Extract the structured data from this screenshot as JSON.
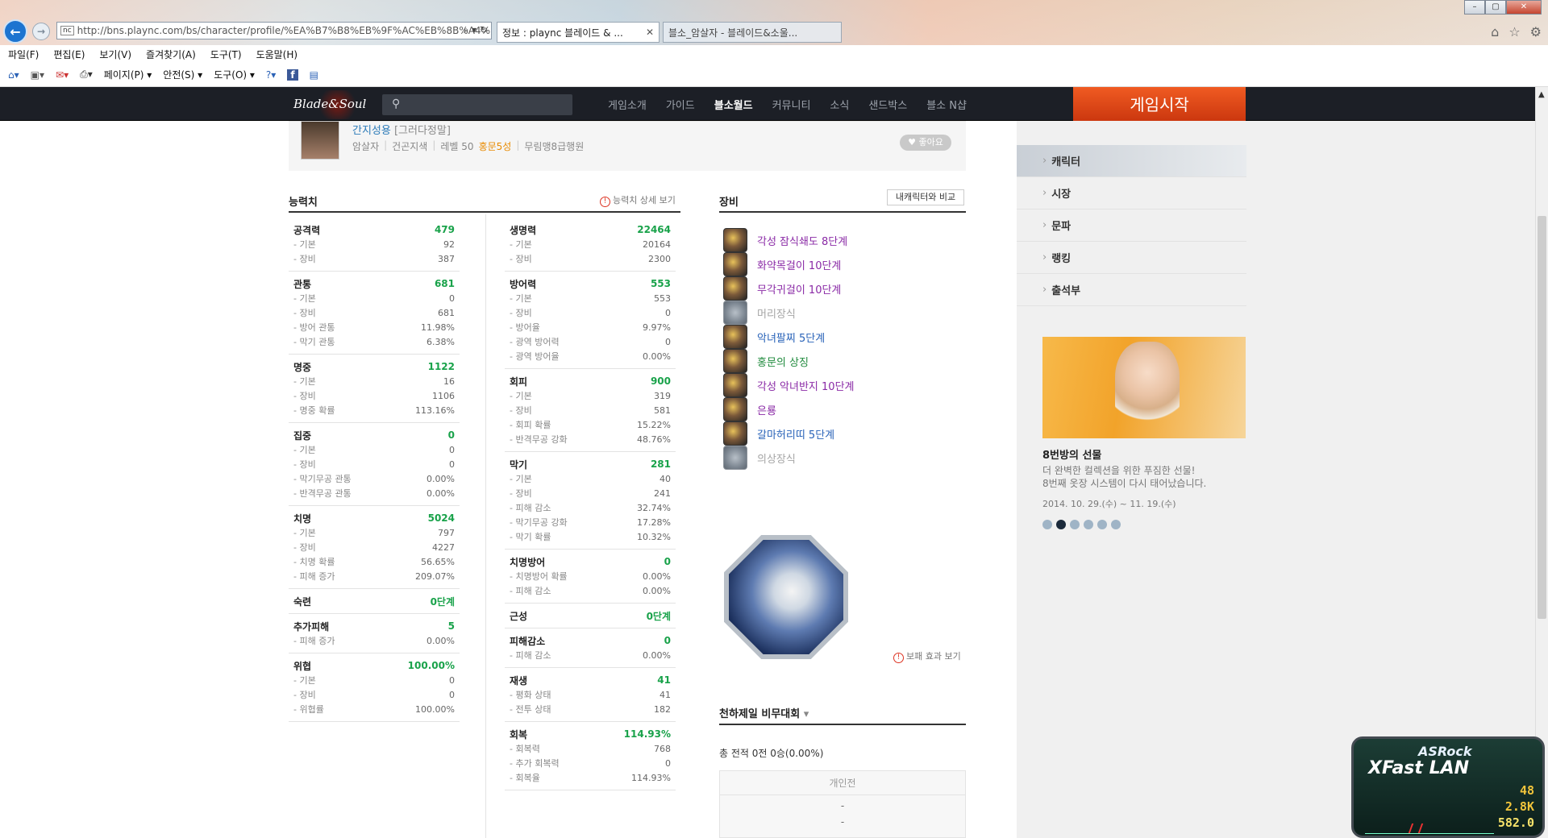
{
  "browser": {
    "url": "http://bns.plaync.com/bs/character/profile/%EA%B7%B8%EB%9F%AC%EB%8B%A4%",
    "tabs": [
      {
        "label": "정보 : plaync 블레이드 & ..."
      },
      {
        "label": "블소_암살자 - 블레이드&소울..."
      }
    ],
    "menu": [
      "파일(F)",
      "편집(E)",
      "보기(V)",
      "즐겨찾기(A)",
      "도구(T)",
      "도움말(H)"
    ],
    "cmd": [
      "페이지(P) ▾",
      "안전(S) ▾",
      "도구(O) ▾"
    ]
  },
  "site": {
    "logo": "Blade&Soul",
    "nav": [
      "게임소개",
      "가이드",
      "블소월드",
      "커뮤니티",
      "소식",
      "샌드박스",
      "블소 N샵"
    ],
    "active_nav": "블소월드",
    "start_button": "게임시작"
  },
  "profile": {
    "name": "간지성용",
    "server": "[그러다정말]",
    "class": "암살자",
    "race": "건곤지색",
    "level": "레벨 50",
    "mastery": "홍문5성",
    "faction": "무림맹8급행원",
    "like": "좋아요"
  },
  "stats": {
    "title": "능력치",
    "detail_link": "능력치 상세 보기",
    "left": [
      {
        "name": "공격력",
        "value": "479",
        "rows": [
          [
            "- 기본",
            "92"
          ],
          [
            "- 장비",
            "387"
          ]
        ]
      },
      {
        "name": "관통",
        "value": "681",
        "rows": [
          [
            "- 기본",
            "0"
          ],
          [
            "- 장비",
            "681"
          ],
          [
            "- 방어 관통",
            "11.98%"
          ],
          [
            "- 막기 관통",
            "6.38%"
          ]
        ]
      },
      {
        "name": "명중",
        "value": "1122",
        "rows": [
          [
            "- 기본",
            "16"
          ],
          [
            "- 장비",
            "1106"
          ],
          [
            "- 명중 확률",
            "113.16%"
          ]
        ]
      },
      {
        "name": "집중",
        "value": "0",
        "rows": [
          [
            "- 기본",
            "0"
          ],
          [
            "- 장비",
            "0"
          ],
          [
            "- 막기무공 관통",
            "0.00%"
          ],
          [
            "- 반격무공 관통",
            "0.00%"
          ]
        ]
      },
      {
        "name": "치명",
        "value": "5024",
        "rows": [
          [
            "- 기본",
            "797"
          ],
          [
            "- 장비",
            "4227"
          ],
          [
            "- 치명 확률",
            "56.65%"
          ],
          [
            "- 피해 증가",
            "209.07%"
          ]
        ]
      },
      {
        "name": "숙련",
        "value": "0단계",
        "rows": []
      },
      {
        "name": "추가피해",
        "value": "5",
        "rows": [
          [
            "- 피해 증가",
            "0.00%"
          ]
        ]
      },
      {
        "name": "위협",
        "value": "100.00%",
        "rows": [
          [
            "- 기본",
            "0"
          ],
          [
            "- 장비",
            "0"
          ],
          [
            "- 위협률",
            "100.00%"
          ]
        ]
      }
    ],
    "right": [
      {
        "name": "생명력",
        "value": "22464",
        "rows": [
          [
            "- 기본",
            "20164"
          ],
          [
            "- 장비",
            "2300"
          ]
        ]
      },
      {
        "name": "방어력",
        "value": "553",
        "rows": [
          [
            "- 기본",
            "553"
          ],
          [
            "- 장비",
            "0"
          ],
          [
            "- 방어율",
            "9.97%"
          ],
          [
            "- 광역 방어력",
            "0"
          ],
          [
            "- 광역 방어율",
            "0.00%"
          ]
        ]
      },
      {
        "name": "회피",
        "value": "900",
        "rows": [
          [
            "- 기본",
            "319"
          ],
          [
            "- 장비",
            "581"
          ],
          [
            "- 회피 확률",
            "15.22%"
          ],
          [
            "- 반격무공 강화",
            "48.76%"
          ]
        ]
      },
      {
        "name": "막기",
        "value": "281",
        "rows": [
          [
            "- 기본",
            "40"
          ],
          [
            "- 장비",
            "241"
          ],
          [
            "- 피해 감소",
            "32.74%"
          ],
          [
            "- 막기무공 강화",
            "17.28%"
          ],
          [
            "- 막기 확률",
            "10.32%"
          ]
        ]
      },
      {
        "name": "치명방어",
        "value": "0",
        "rows": [
          [
            "- 치명방어 확률",
            "0.00%"
          ],
          [
            "- 피해 감소",
            "0.00%"
          ]
        ]
      },
      {
        "name": "근성",
        "value": "0단계",
        "rows": []
      },
      {
        "name": "피해감소",
        "value": "0",
        "rows": [
          [
            "- 피해 감소",
            "0.00%"
          ]
        ]
      },
      {
        "name": "재생",
        "value": "41",
        "rows": [
          [
            "- 평화 상태",
            "41"
          ],
          [
            "- 전투 상태",
            "182"
          ]
        ]
      },
      {
        "name": "회복",
        "value": "114.93%",
        "rows": [
          [
            "- 회복력",
            "768"
          ],
          [
            "- 추가 회복력",
            "0"
          ],
          [
            "- 회복율",
            "114.93%"
          ]
        ]
      }
    ]
  },
  "equipment": {
    "title": "장비",
    "compare": "내캐릭터와 비교",
    "items": [
      {
        "name": "각성 잠식쇄도 8단계",
        "color": "purple",
        "empty": false
      },
      {
        "name": "화약목걸이 10단계",
        "color": "purple",
        "empty": false
      },
      {
        "name": "무각귀걸이 10단계",
        "color": "purple",
        "empty": false
      },
      {
        "name": "머리장식",
        "color": "grey",
        "empty": true
      },
      {
        "name": "악녀팔찌 5단계",
        "color": "blue",
        "empty": false
      },
      {
        "name": "홍문의 상징",
        "color": "green",
        "empty": false
      },
      {
        "name": "각성 악녀반지 10단계",
        "color": "purple",
        "empty": false
      },
      {
        "name": "은룡",
        "color": "purple",
        "empty": false
      },
      {
        "name": "갈마허리띠 5단계",
        "color": "blue",
        "empty": false
      },
      {
        "name": "의상장식",
        "color": "grey",
        "empty": true
      }
    ],
    "soul_link": "보패 효과 보기"
  },
  "tournament": {
    "title": "천하제일 비무대회",
    "summary": "총 전적  0전  0승(0.00%)",
    "header": "개인전",
    "dash": "-"
  },
  "sidebar": {
    "items": [
      "캐릭터",
      "시장",
      "문파",
      "랭킹",
      "출석부"
    ],
    "active": "캐릭터",
    "promo_title": "8번방의 선물",
    "promo_desc1": "더 완벽한 컬렉션을 위한 푸짐한 선물!",
    "promo_desc2": "8번째 옷장 시스템이 다시 태어났습니다.",
    "promo_date": "2014. 10. 29.(수) ~ 11. 19.(수)"
  },
  "widget": {
    "brand": "ASRock",
    "title": "XFast LAN",
    "v1": "48",
    "v2": "2.8K",
    "v3": "582.0"
  }
}
